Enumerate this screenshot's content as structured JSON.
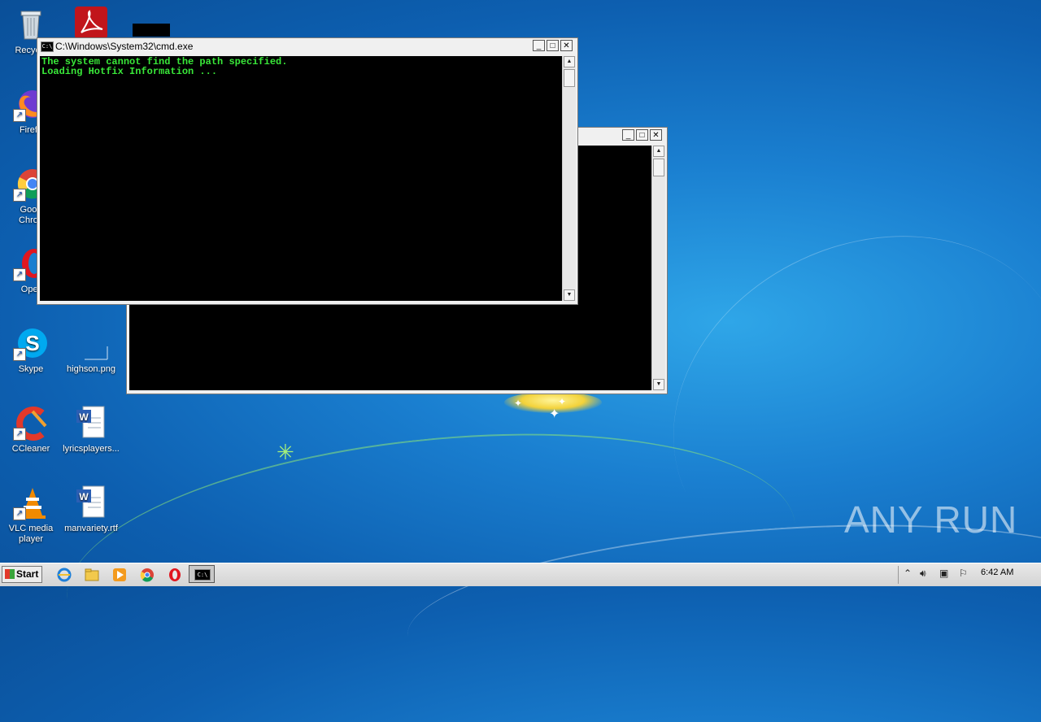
{
  "desktop": {
    "icons": [
      {
        "label": "Recycle",
        "icon": "recycle-bin-icon"
      },
      {
        "label": "Firefo",
        "icon": "firefox-icon"
      },
      {
        "label": "Goog\nChron",
        "icon": "chrome-icon"
      },
      {
        "label": "Oper",
        "icon": "opera-icon"
      },
      {
        "label": "Skype",
        "icon": "skype-icon"
      },
      {
        "label": "CCleaner",
        "icon": "ccleaner-icon"
      },
      {
        "label": "VLC media\nplayer",
        "icon": "vlc-icon"
      },
      {
        "label": "",
        "icon": "acrobat-icon"
      },
      {
        "label": "highson.png",
        "icon": "image-file-icon"
      },
      {
        "label": "lyricsplayers...",
        "icon": "word-document-icon"
      },
      {
        "label": "manvariety.rtf",
        "icon": "word-document-icon"
      }
    ],
    "watermark": "ANY RUN"
  },
  "cmd_front": {
    "title": "C:\\Windows\\System32\\cmd.exe",
    "lines": [
      "The system cannot find the path specified.",
      "Loading Hotfix Information ..."
    ]
  },
  "cmd_back": {
    "title": ""
  },
  "taskbar": {
    "start_label": "Start",
    "pinned": [
      "internet-explorer-icon",
      "explorer-folder-icon",
      "media-player-icon",
      "chrome-icon",
      "opera-icon"
    ],
    "active_task": "cmd-icon",
    "clock": "6:42 AM"
  },
  "colors": {
    "console_text": "#39e839",
    "desktop_blue": "#1a7fd0"
  }
}
